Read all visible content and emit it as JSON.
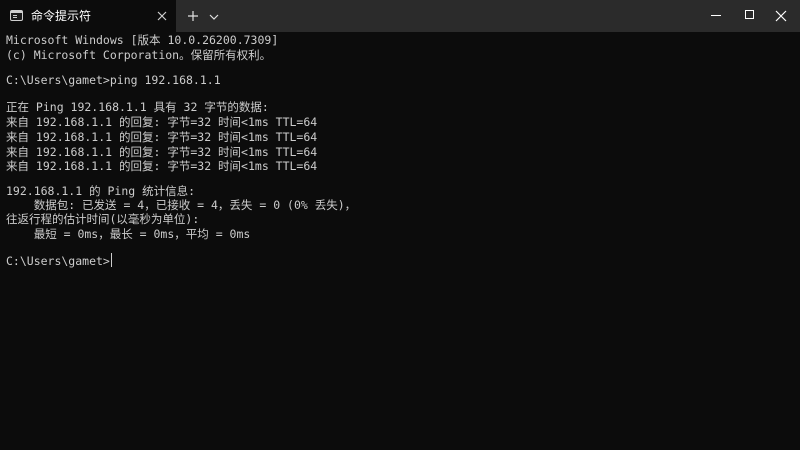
{
  "window": {
    "tab_title": "命令提示符",
    "tab_icon": "terminal-icon",
    "close_tab_icon": "close-icon",
    "new_tab_icon": "plus-icon",
    "dropdown_icon": "chevron-down-icon",
    "controls": [
      "minimize-icon",
      "maximize-icon",
      "close-icon"
    ]
  },
  "console": {
    "lines": [
      "Microsoft Windows [版本 10.0.26200.7309]",
      "(c) Microsoft Corporation。保留所有权利。",
      "",
      "C:\\Users\\gamet>ping 192.168.1.1",
      "",
      "正在 Ping 192.168.1.1 具有 32 字节的数据:",
      "来自 192.168.1.1 的回复: 字节=32 时间<1ms TTL=64",
      "来自 192.168.1.1 的回复: 字节=32 时间<1ms TTL=64",
      "来自 192.168.1.1 的回复: 字节=32 时间<1ms TTL=64",
      "来自 192.168.1.1 的回复: 字节=32 时间<1ms TTL=64",
      "",
      "192.168.1.1 的 Ping 统计信息:",
      "    数据包: 已发送 = 4，已接收 = 4，丢失 = 0 (0% 丢失)，",
      "往返行程的估计时间(以毫秒为单位):",
      "    最短 = 0ms，最长 = 0ms，平均 = 0ms",
      "",
      "C:\\Users\\gamet>"
    ]
  },
  "colors": {
    "background": "#0c0c0c",
    "titlebar": "#2b2b2b",
    "text": "#cccccc"
  }
}
